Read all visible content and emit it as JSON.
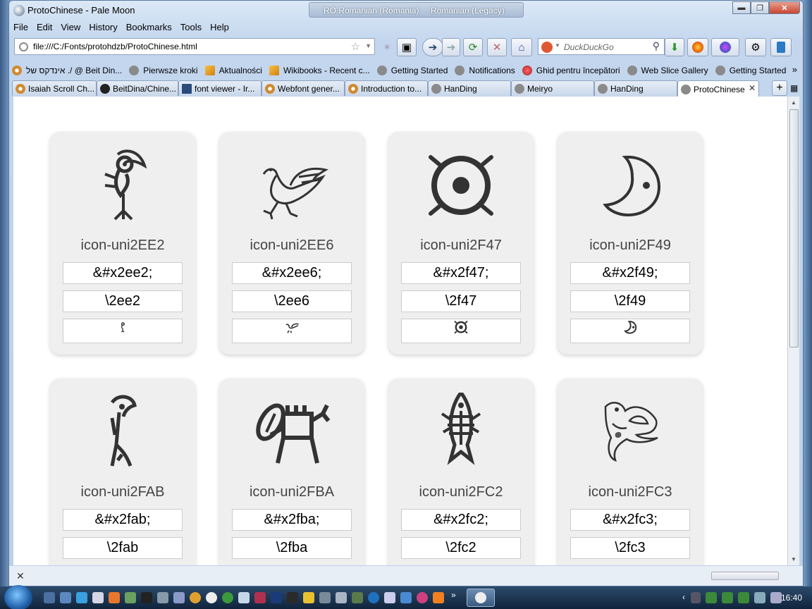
{
  "window": {
    "title": "ProtoChinese - Pale Moon",
    "lang_left": "RO Romanian (Romania)",
    "lang_right": "Romanian (Legacy)"
  },
  "menu": [
    "File",
    "Edit",
    "View",
    "History",
    "Bookmarks",
    "Tools",
    "Help"
  ],
  "url": "file:///C:/Fonts/protohdzb/ProtoChinese.html",
  "search_placeholder": "DuckDuckGo",
  "bookmarks": [
    {
      "label": "אינדקס של ./ @ Beit Din...",
      "icon": "gear-icon"
    },
    {
      "label": "Pierwsze kroki",
      "icon": "globe-icon"
    },
    {
      "label": "Aktualności",
      "icon": "rss-icon"
    },
    {
      "label": "Wikibooks - Recent c...",
      "icon": "rss-icon"
    },
    {
      "label": "Getting Started",
      "icon": "globe-icon"
    },
    {
      "label": "Notifications",
      "icon": "globe-icon"
    },
    {
      "label": "Ghid pentru începători",
      "icon": "mozilla-icon"
    },
    {
      "label": "Web Slice Gallery",
      "icon": "globe-icon"
    },
    {
      "label": "Getting Started",
      "icon": "globe-icon"
    }
  ],
  "tabs": [
    {
      "label": "Isaiah Scroll Ch...",
      "icon": "gear"
    },
    {
      "label": "BeitDina/Chine...",
      "icon": "gh"
    },
    {
      "label": "font viewer - Ir...",
      "icon": "doc"
    },
    {
      "label": "Webfont gener...",
      "icon": "gear"
    },
    {
      "label": "Introduction to...",
      "icon": "gear"
    },
    {
      "label": "HanDing",
      "icon": "globe"
    },
    {
      "label": "Meiryo",
      "icon": "globe"
    },
    {
      "label": "HanDing",
      "icon": "globe"
    },
    {
      "label": "ProtoChinese",
      "icon": "globe"
    }
  ],
  "cards": [
    {
      "name": "icon-uni2EE2",
      "entity": "&#x2ee2;",
      "css": "\\2ee2",
      "glyph": "bird-standing"
    },
    {
      "name": "icon-uni2EE6",
      "entity": "&#x2ee6;",
      "css": "\\2ee6",
      "glyph": "bird-flying"
    },
    {
      "name": "icon-uni2F47",
      "entity": "&#x2f47;",
      "css": "\\2f47",
      "glyph": "sun"
    },
    {
      "name": "icon-uni2F49",
      "entity": "&#x2f49;",
      "css": "\\2f49",
      "glyph": "moon"
    },
    {
      "name": "icon-uni2FAB",
      "entity": "&#x2fab;",
      "css": "\\2fab",
      "glyph": "tall-bird"
    },
    {
      "name": "icon-uni2FBA",
      "entity": "&#x2fba;",
      "css": "\\2fba",
      "glyph": "creature"
    },
    {
      "name": "icon-uni2FC2",
      "entity": "&#x2fc2;",
      "css": "\\2fc2",
      "glyph": "fish"
    },
    {
      "name": "icon-uni2FC3",
      "entity": "&#x2fc3;",
      "css": "\\2fc3",
      "glyph": "bird-sketch"
    }
  ],
  "clock": "16:40"
}
